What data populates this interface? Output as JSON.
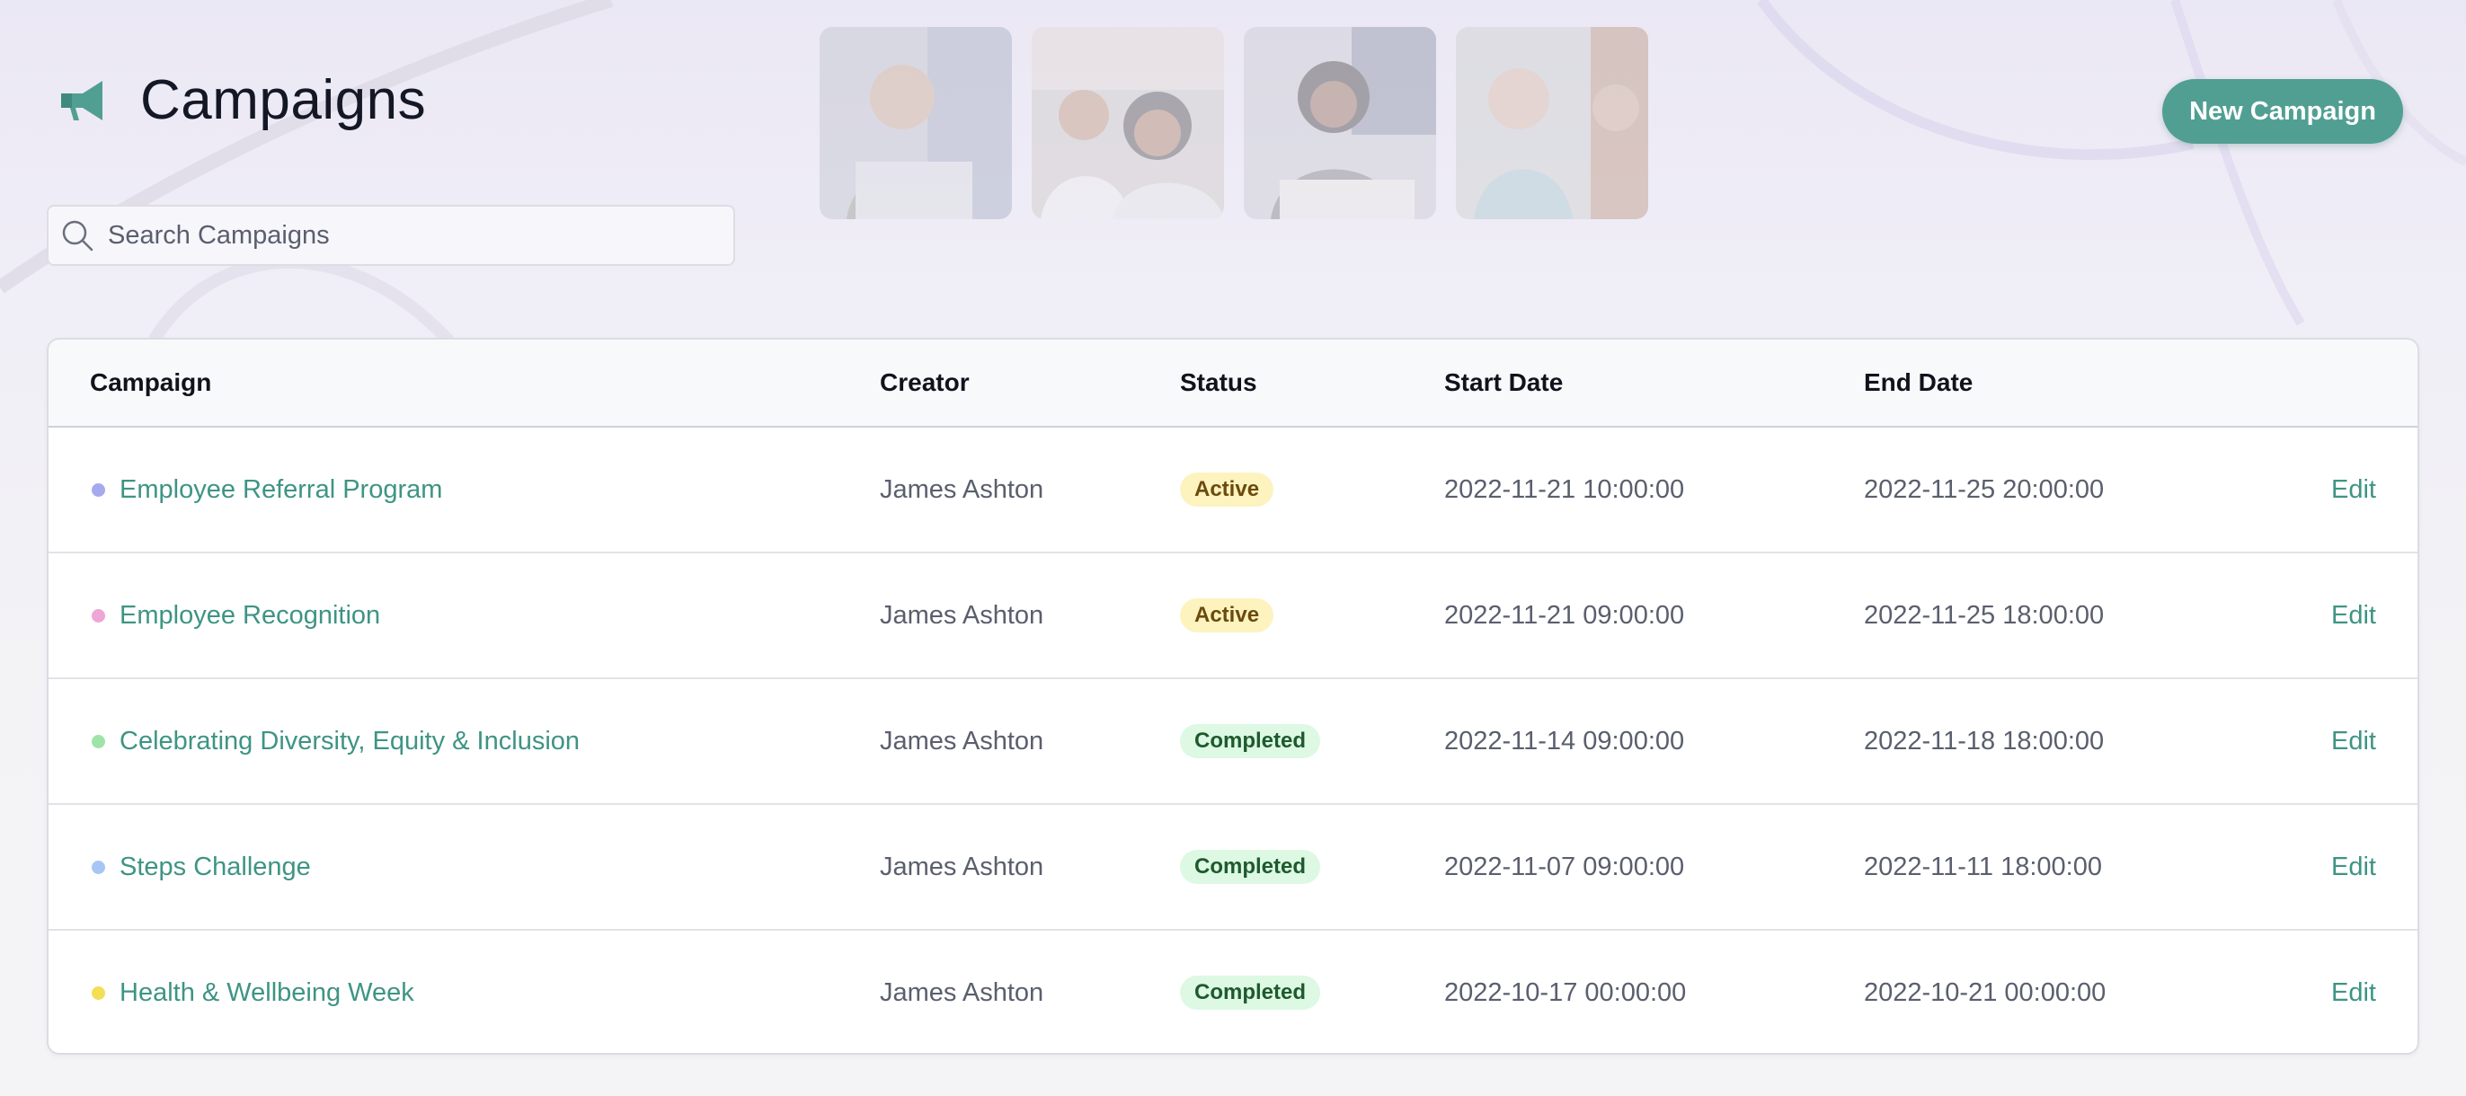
{
  "header": {
    "title": "Campaigns",
    "icon": "megaphone-icon",
    "new_campaign_label": "New Campaign"
  },
  "search": {
    "placeholder": "Search Campaigns",
    "value": ""
  },
  "colors": {
    "accent": "#519f93",
    "link": "#3e9484",
    "active_badge_bg": "#fcf3bf",
    "completed_badge_bg": "#ddf8e3"
  },
  "table": {
    "columns": [
      "Campaign",
      "Creator",
      "Status",
      "Start Date",
      "End Date"
    ],
    "rows": [
      {
        "name": "Employee Referral Program",
        "dot_color": "#a6a9ee",
        "creator": "James Ashton",
        "status": "Active",
        "start": "2022-11-21 10:00:00",
        "end": "2022-11-25 20:00:00",
        "action": "Edit"
      },
      {
        "name": "Employee Recognition",
        "dot_color": "#eea6d6",
        "creator": "James Ashton",
        "status": "Active",
        "start": "2022-11-21 09:00:00",
        "end": "2022-11-25 18:00:00",
        "action": "Edit"
      },
      {
        "name": "Celebrating Diversity, Equity & Inclusion",
        "dot_color": "#9fe3a8",
        "creator": "James Ashton",
        "status": "Completed",
        "start": "2022-11-14 09:00:00",
        "end": "2022-11-18 18:00:00",
        "action": "Edit"
      },
      {
        "name": "Steps Challenge",
        "dot_color": "#a7c6f3",
        "creator": "James Ashton",
        "status": "Completed",
        "start": "2022-11-07 09:00:00",
        "end": "2022-11-11 18:00:00",
        "action": "Edit"
      },
      {
        "name": "Health & Wellbeing Week",
        "dot_color": "#f2df54",
        "creator": "James Ashton",
        "status": "Completed",
        "start": "2022-10-17 00:00:00",
        "end": "2022-10-21 00:00:00",
        "action": "Edit"
      }
    ]
  }
}
